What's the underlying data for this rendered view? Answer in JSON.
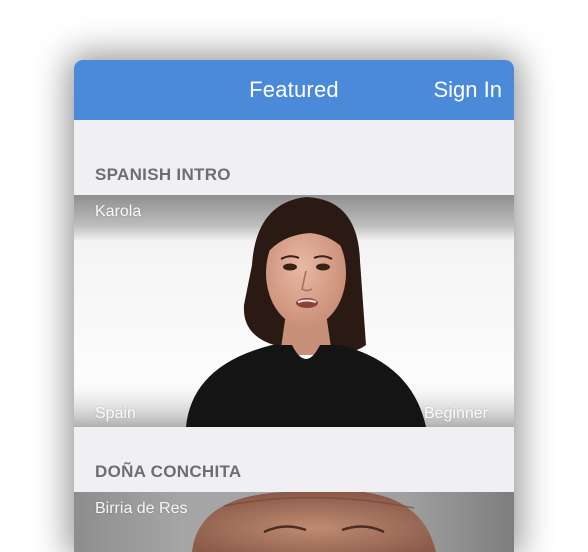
{
  "navbar": {
    "title": "Featured",
    "sign_in_label": "Sign In",
    "color": "#4a8ad9"
  },
  "sections": [
    {
      "header": "SPANISH INTRO",
      "card": {
        "title": "Karola",
        "location": "Spain",
        "level": "Beginner"
      }
    },
    {
      "header": "DOÑA CONCHITA",
      "card": {
        "title": "Birria de Res"
      }
    }
  ]
}
